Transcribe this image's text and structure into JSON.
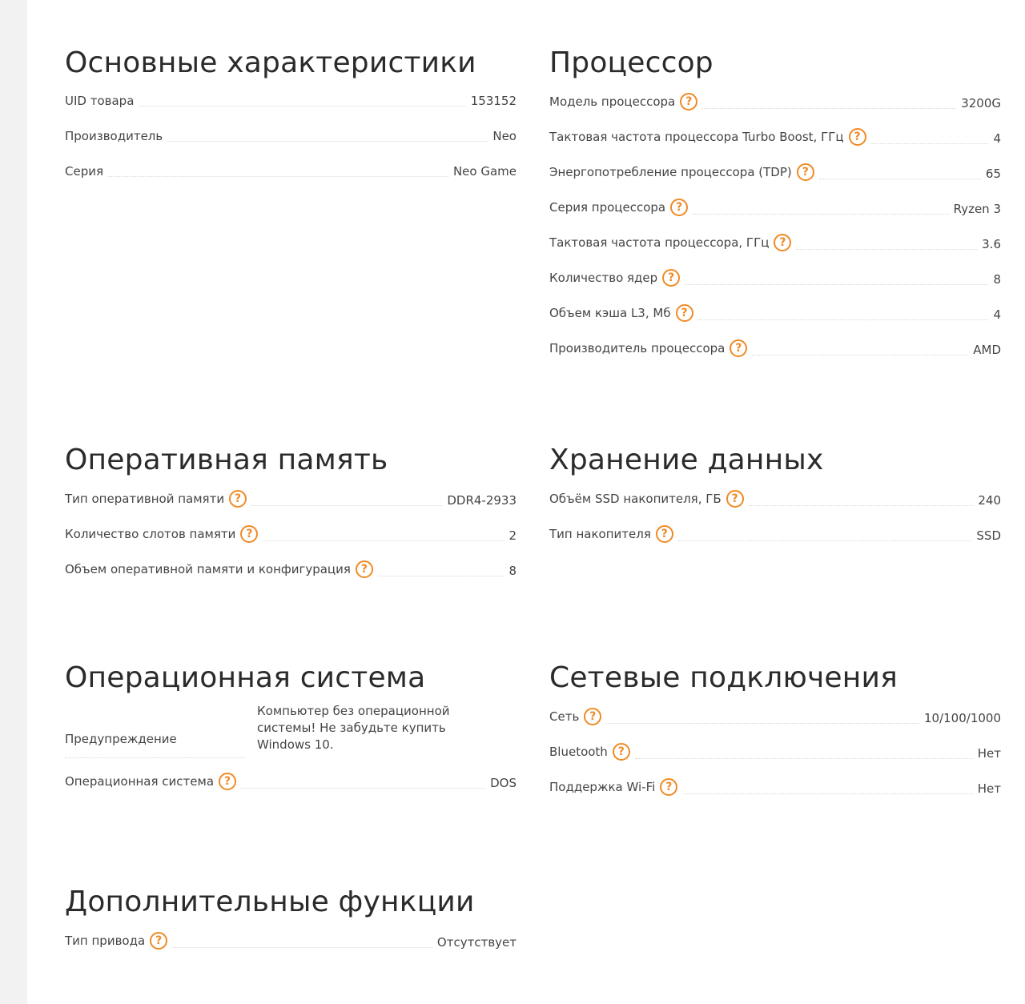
{
  "sections": {
    "basic": {
      "title": "Основные характеристики",
      "rows": [
        {
          "label": "UID товара",
          "value": "153152"
        },
        {
          "label": "Производитель",
          "value": "Neo"
        },
        {
          "label": "Серия",
          "value": "Neo Game"
        }
      ]
    },
    "cpu": {
      "title": "Процессор",
      "rows": [
        {
          "label": "Модель процессора",
          "value": "3200G"
        },
        {
          "label": "Тактовая частота процессора Turbo Boost, ГГц",
          "value": "4"
        },
        {
          "label": "Энергопотребление процессора (TDP)",
          "value": "65"
        },
        {
          "label": "Серия процессора",
          "value": "Ryzen 3"
        },
        {
          "label": "Тактовая частота процессора, ГГц",
          "value": "3.6"
        },
        {
          "label": "Количество ядер",
          "value": "8"
        },
        {
          "label": "Объем кэша L3, Мб",
          "value": "4"
        },
        {
          "label": "Производитель процессора",
          "value": "AMD"
        }
      ]
    },
    "ram": {
      "title": "Оперативная память",
      "rows": [
        {
          "label": "Тип оперативной памяти",
          "value": "DDR4-2933"
        },
        {
          "label": "Количество слотов памяти",
          "value": "2"
        },
        {
          "label": "Объем оперативной памяти и конфигурация",
          "value": "8"
        }
      ]
    },
    "storage": {
      "title": "Хранение данных",
      "rows": [
        {
          "label": "Объём SSD накопителя, ГБ",
          "value": "240"
        },
        {
          "label": "Тип накопителя",
          "value": "SSD"
        }
      ]
    },
    "os": {
      "title": "Операционная система",
      "rows": [
        {
          "label": "Предупреждение",
          "value": "Компьютер без операционной системы! Не забудьте купить Windows 10."
        },
        {
          "label": "Операционная система",
          "value": "DOS"
        }
      ]
    },
    "network": {
      "title": "Сетевые подключения",
      "rows": [
        {
          "label": "Сеть",
          "value": "10/100/1000"
        },
        {
          "label": "Bluetooth",
          "value": "Нет"
        },
        {
          "label": "Поддержка Wi-Fi",
          "value": "Нет"
        }
      ]
    },
    "extra": {
      "title": "Дополнительные функции",
      "rows": [
        {
          "label": "Тип привода",
          "value": "Отсутствует"
        }
      ]
    }
  },
  "help_icon_glyph": "?",
  "accent_color": "#f08a24"
}
